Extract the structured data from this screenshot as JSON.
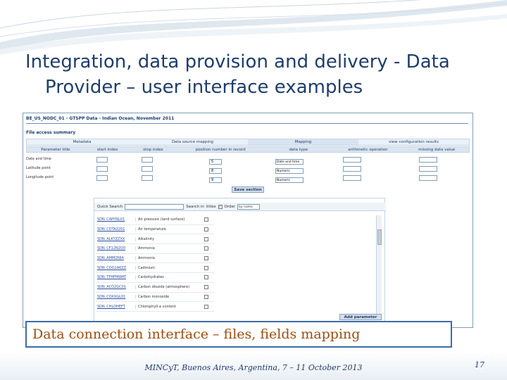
{
  "slide": {
    "title_line1": "Integration, data provision and delivery - Data",
    "title_line2": "Provider – user interface examples",
    "caption": "Data connection interface – files, fields mapping",
    "footer": "MINCyT, Buenos Aires, Argentina, 7 – 11 October 2013",
    "page_number": "17"
  },
  "screenshot": {
    "header": "BE_US_NODC_01 - GTSPP Data - Indian Ocean, November 2011",
    "subheader": "File access summary",
    "tabs": [
      "Metadata",
      "Data source mapping",
      "Mapping",
      "view configuration results"
    ],
    "active_tab": "Mapping",
    "columns": [
      "Parameter title",
      "start index",
      "stop index",
      "position number in record",
      "data type",
      "arithmetic operation",
      "missing data value"
    ],
    "rows": [
      {
        "title": "Date and time",
        "position": "5",
        "data_type": "Date and time"
      },
      {
        "title": "Latitude point",
        "position": "8",
        "data_type": "Numeric"
      },
      {
        "title": "Longitude point",
        "position": "9",
        "data_type": "Numeric"
      }
    ],
    "save_button": "Save section",
    "search": {
      "label": "Quick Search",
      "search_in": "Search in",
      "titles": "titles",
      "order": "Order",
      "order_value": "by name"
    },
    "parameters": [
      {
        "code": "SDN_CAPHSL01",
        "name": "Air pressure (land surface)"
      },
      {
        "code": "SDN_CDTA2201",
        "name": "Air temperature"
      },
      {
        "code": "SDN_ALKYZZXX",
        "name": "Alkalinity"
      },
      {
        "code": "SDN_CF12N2O0",
        "name": "Ammonia"
      },
      {
        "code": "SDN_AMMONIA",
        "name": "Ammonia"
      },
      {
        "code": "SDN_CDO1A6ZZ",
        "name": "Cadmium"
      },
      {
        "code": "SDN_TPHFMWAT",
        "name": "Carbohydrates"
      },
      {
        "code": "SDN_ACO2GC01",
        "name": "Carbon dioxide (atmosphere)"
      },
      {
        "code": "SDN_COXXGL01",
        "name": "Carbon monoxide"
      },
      {
        "code": "SDN_CHLOHEFT",
        "name": "Chlorophyll-a content"
      }
    ],
    "add_button": "Add parameter"
  }
}
